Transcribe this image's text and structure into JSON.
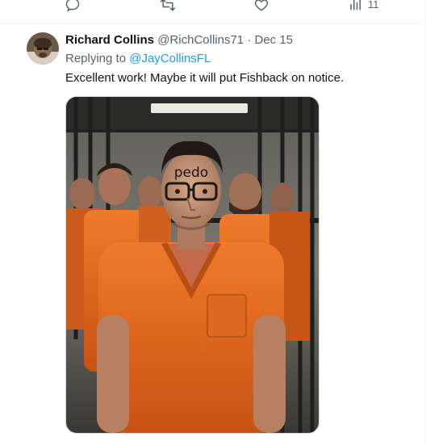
{
  "prev_post": {
    "actions": {
      "reply_icon": "reply-icon",
      "repost_icon": "repost-icon",
      "like_icon": "like-icon",
      "views_icon": "views-icon",
      "views_count": "11"
    }
  },
  "reply": {
    "display_name": "Richard Collins",
    "handle": "@RichCollins71",
    "separator": "·",
    "date": "Dec 15",
    "replying_to_prefix": "Replying to",
    "replying_to_handle": "@JayCollinsFL",
    "text": "Excellent work! Maybe it will put Fishback on notice.",
    "media": {
      "forehead_text": "pedo"
    }
  },
  "colors": {
    "link": "#1d9bf0",
    "secondary_text": "#536471",
    "jumpsuit": "#e8671e"
  }
}
